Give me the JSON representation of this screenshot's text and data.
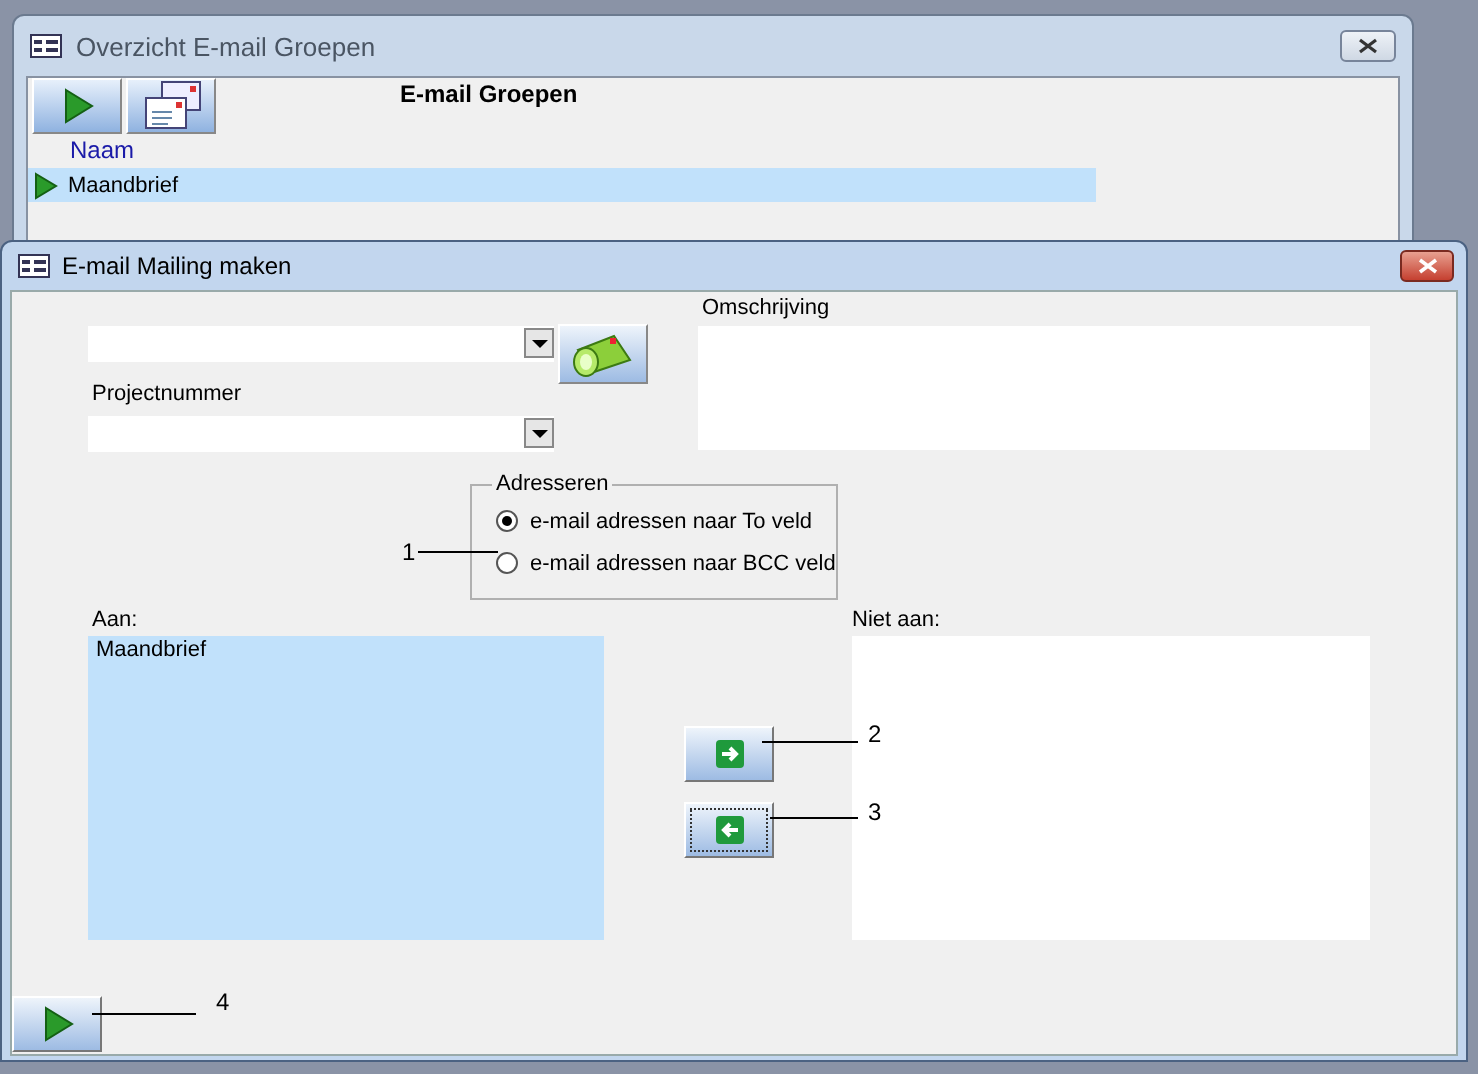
{
  "overview_window": {
    "title": "Overzicht E-mail Groepen",
    "heading": "E-mail Groepen",
    "column": "Naam",
    "rows": [
      {
        "name": "Maandbrief",
        "selected": true
      }
    ]
  },
  "mailing_window": {
    "title": "E-mail Mailing maken",
    "project_label": "Projectnummer",
    "description_label": "Omschrijving",
    "addressing": {
      "legend": "Adresseren",
      "options": [
        {
          "label": "e-mail adressen naar To veld",
          "selected": true
        },
        {
          "label": "e-mail adressen naar BCC veld",
          "selected": false
        }
      ]
    },
    "to_list": {
      "label": "Aan:",
      "items": [
        "Maandbrief"
      ]
    },
    "not_to_list": {
      "label": "Niet aan:"
    },
    "callouts": [
      "1",
      "2",
      "3",
      "4"
    ]
  }
}
